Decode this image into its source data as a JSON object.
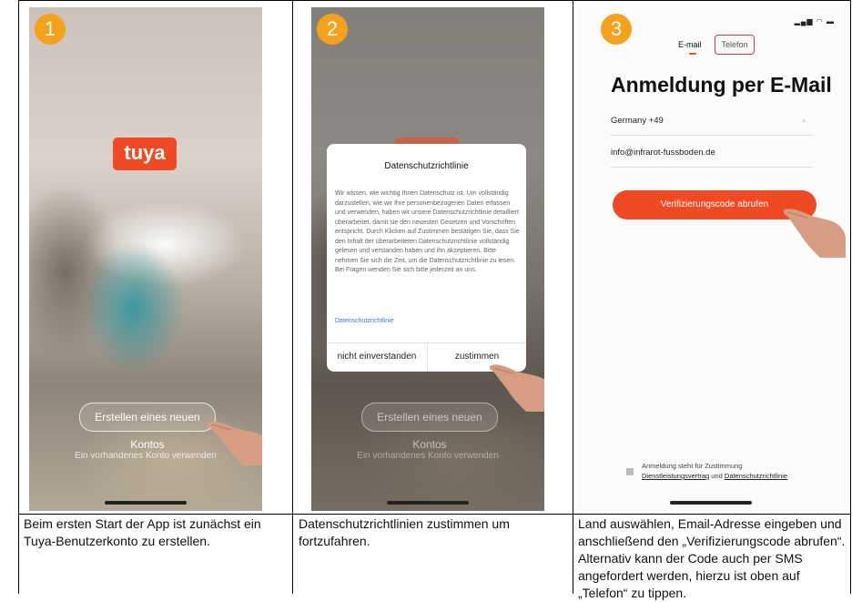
{
  "panels": [
    {
      "step": "1",
      "logo_text": "tuya",
      "create_button": "Erstellen eines neuen Kontos",
      "existing_link": "Ein vorhandenes Konto verwenden",
      "caption": "Beim ersten Start der App ist zunächst ein Tuya-Benutzerkonto zu erstellen."
    },
    {
      "step": "2",
      "dialog_title": "Datenschutzrichtlinie",
      "dialog_body": "Wir wissen, wie wichtig Ihnen Datenschutz ist. Um vollständig darzustellen, wie wir Ihre personenbezogenen Daten erfassen und verwenden, haben wir unsere Datenschutzrichtlinie detailliert überarbeitet, damit sie den neuesten Gesetzen und Vorschriften entspricht. Durch Klicken auf Zustimmen bestätigen Sie, dass Sie den Inhalt der überarbeiteten Datenschutzrichtlinie vollständig gelesen und verstanden haben und ihn akzeptieren. Bitte nehmen Sie sich die Zeit, um die Datenschutzrichtlinie zu lesen. Bei Fragen wenden Sie sich bitte jederzeit an uns.",
      "dialog_link": "Datenschutzrichtlinie",
      "decline_button": "nicht einverstanden",
      "accept_button": "zustimmen",
      "create_button": "Erstellen eines neuen Kontos",
      "existing_link": "Ein vorhandenes Konto verwenden",
      "caption": "Datenschutzrichtlinien zustimmen um fortzufahren."
    },
    {
      "step": "3",
      "tab_email": "E-mail",
      "tab_phone": "Telefon",
      "title": "Anmeldung per E-Mail",
      "country_value": "Germany +49",
      "email_value": "info@infrarot-fussboden.de",
      "verify_button": "Verifizierungscode abrufen",
      "consent_line1": "Anmeldung steht für Zustimmung",
      "consent_link1": "Dienstleistungsvertrag",
      "consent_and": " und ",
      "consent_link2": "Datenschutzrichtlinie",
      "caption": "Land auswählen, Email-Adresse eingeben und anschließend den „Verifizierungscode abrufen“. Alternativ kann der Code auch per SMS angefordert werden, hierzu ist oben auf „Telefon“ zu tippen."
    }
  ],
  "colors": {
    "brand_orange": "#ef4a23",
    "step_badge": "#f4a21a",
    "phone_tab_outline": "#c9404a"
  }
}
